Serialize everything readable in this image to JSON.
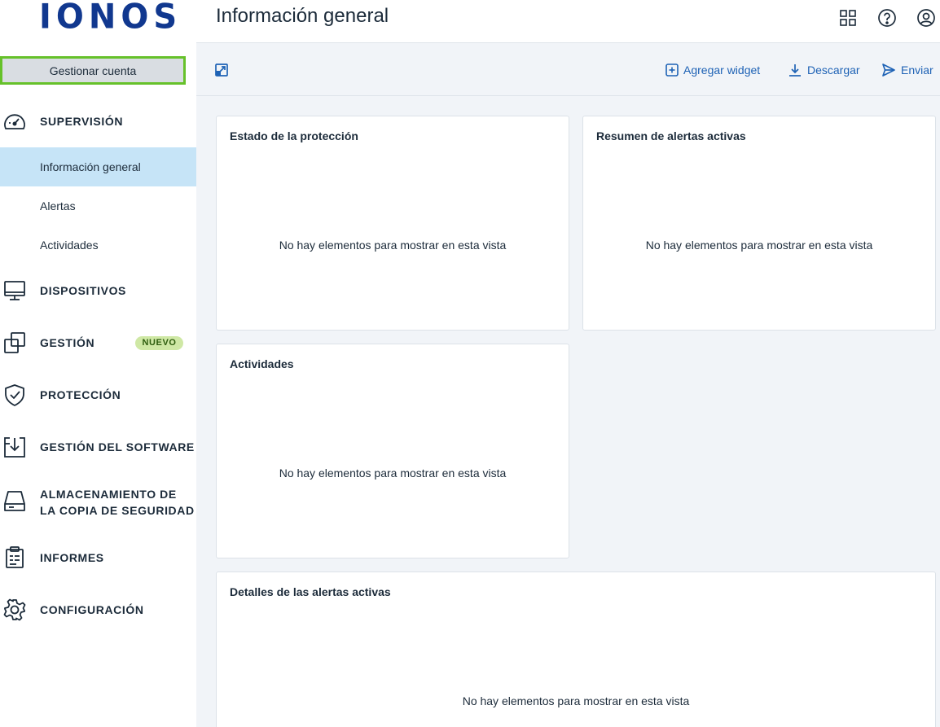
{
  "brand": {
    "logo_text": "IONOS",
    "accent": "#11388f",
    "link_color": "#1e62b5",
    "highlight": "#66c12a"
  },
  "sidebar": {
    "account_button": "Gestionar cuenta",
    "sections": [
      {
        "label": "SUPERVISIÓN",
        "icon": "speedometer-icon",
        "items": [
          {
            "label": "Información general",
            "active": true
          },
          {
            "label": "Alertas",
            "active": false
          },
          {
            "label": "Actividades",
            "active": false
          }
        ]
      },
      {
        "label": "DISPOSITIVOS",
        "icon": "monitor-icon"
      },
      {
        "label": "GESTIÓN",
        "icon": "copy-squares-icon",
        "badge": "NUEVO"
      },
      {
        "label": "PROTECCIÓN",
        "icon": "shield-check-icon"
      },
      {
        "label": "GESTIÓN DEL SOFTWARE",
        "icon": "software-download-icon"
      },
      {
        "label_line1": "ALMACENAMIENTO DE",
        "label_line2": "LA COPIA DE SEGURIDAD",
        "icon": "storage-drive-icon"
      },
      {
        "label": "INFORMES",
        "icon": "clipboard-report-icon"
      },
      {
        "label": "CONFIGURACIÓN",
        "icon": "gear-icon"
      }
    ]
  },
  "header": {
    "title": "Información general",
    "icons": [
      "grid-icon",
      "help-icon",
      "user-icon"
    ]
  },
  "toolbar": {
    "add_widget": "Agregar widget",
    "download": "Descargar",
    "send": "Enviar"
  },
  "widgets": [
    {
      "title": "Estado de la protección",
      "empty": "No hay elementos para mostrar en esta vista"
    },
    {
      "title": "Resumen de alertas activas",
      "empty": "No hay elementos para mostrar en esta vista"
    },
    {
      "title": "Actividades",
      "empty": "No hay elementos para mostrar en esta vista"
    },
    {
      "title": "Detalles de las alertas activas",
      "empty": "No hay elementos para mostrar en esta vista"
    }
  ]
}
